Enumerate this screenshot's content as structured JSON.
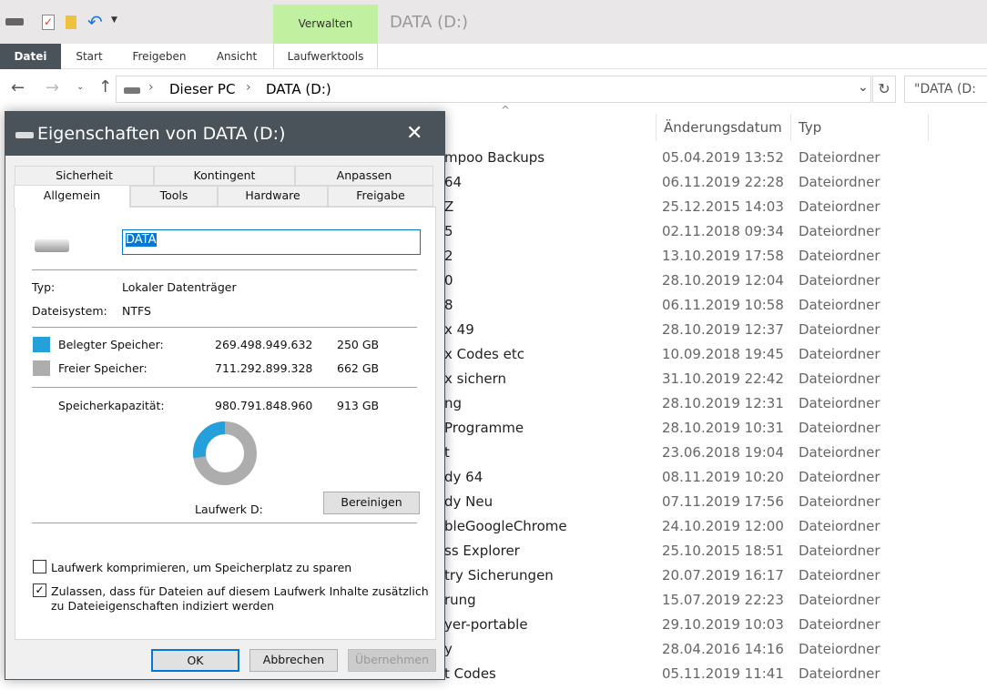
{
  "window": {
    "title": "DATA (D:)",
    "context_tab": "Verwalten",
    "accent": "#c0f0a0"
  },
  "ribbon": {
    "tabs": [
      "Datei",
      "Start",
      "Freigeben",
      "Ansicht",
      "Laufwerktools"
    ]
  },
  "address": {
    "crumbs": [
      "Dieser PC",
      "DATA (D:)"
    ],
    "search_value": "\"DATA (D:"
  },
  "columns": {
    "date": "Änderungsdatum",
    "type": "Typ"
  },
  "files": [
    {
      "name": "mpoo Backups",
      "date": "05.04.2019 13:52",
      "type": "Dateiordner"
    },
    {
      "name": "64",
      "date": "06.11.2019 22:28",
      "type": "Dateiordner"
    },
    {
      "name": "Z",
      "date": "25.12.2015 14:03",
      "type": "Dateiordner"
    },
    {
      "name": "5",
      "date": "02.11.2018 09:34",
      "type": "Dateiordner"
    },
    {
      "name": "2",
      "date": "13.10.2019 17:58",
      "type": "Dateiordner"
    },
    {
      "name": "0",
      "date": "28.10.2019 12:04",
      "type": "Dateiordner"
    },
    {
      "name": "8",
      "date": "06.11.2019 10:58",
      "type": "Dateiordner"
    },
    {
      "name": "x 49",
      "date": "28.10.2019 12:37",
      "type": "Dateiordner"
    },
    {
      "name": "x Codes etc",
      "date": "10.09.2018 19:45",
      "type": "Dateiordner"
    },
    {
      "name": "x sichern",
      "date": "31.10.2019 22:42",
      "type": "Dateiordner"
    },
    {
      "name": "ng",
      "date": "28.10.2019 12:31",
      "type": "Dateiordner"
    },
    {
      "name": "Programme",
      "date": "28.10.2019 10:31",
      "type": "Dateiordner"
    },
    {
      "name": "t",
      "date": "23.06.2018 19:04",
      "type": "Dateiordner"
    },
    {
      "name": "dy 64",
      "date": "08.11.2019 10:20",
      "type": "Dateiordner"
    },
    {
      "name": "dy Neu",
      "date": "07.11.2019 17:56",
      "type": "Dateiordner"
    },
    {
      "name": "bleGoogleChrome",
      "date": "24.10.2019 12:00",
      "type": "Dateiordner"
    },
    {
      "name": "ss Explorer",
      "date": "25.10.2015 18:51",
      "type": "Dateiordner"
    },
    {
      "name": "try Sicherungen",
      "date": "20.07.2019 16:17",
      "type": "Dateiordner"
    },
    {
      "name": "rung",
      "date": "15.07.2019 22:23",
      "type": "Dateiordner"
    },
    {
      "name": "yer-portable",
      "date": "29.10.2019 10:03",
      "type": "Dateiordner"
    },
    {
      "name": "y",
      "date": "28.04.2016 14:16",
      "type": "Dateiordner"
    },
    {
      "name": "t Codes",
      "date": "05.11.2019 11:41",
      "type": "Dateiordner"
    }
  ],
  "dialog": {
    "title": "Eigenschaften von DATA (D:)",
    "tabs_row1": [
      "Sicherheit",
      "Kontingent",
      "Anpassen"
    ],
    "tabs_row2": [
      "Allgemein",
      "Tools",
      "Hardware",
      "Freigabe"
    ],
    "name_value": "DATA",
    "type_label": "Typ:",
    "type_value": "Lokaler Datenträger",
    "fs_label": "Dateisystem:",
    "fs_value": "NTFS",
    "used": {
      "label": "Belegter Speicher:",
      "bytes": "269.498.949.632",
      "size": "250 GB",
      "color": "#26a0da"
    },
    "free": {
      "label": "Freier Speicher:",
      "bytes": "711.292.899.328",
      "size": "662 GB",
      "color": "#adadad"
    },
    "capacity": {
      "label": "Speicherkapazität:",
      "bytes": "980.791.848.960",
      "size": "913 GB"
    },
    "used_fraction": 0.274,
    "drive_label": "Laufwerk D:",
    "cleanup": "Bereinigen",
    "compress": {
      "label": "Laufwerk komprimieren, um Speicherplatz zu sparen",
      "checked": false
    },
    "index": {
      "label1": "Zulassen, dass für Dateien auf diesem Laufwerk Inhalte zusätzlich",
      "label2": "zu Dateieigenschaften indiziert werden",
      "checked": true
    },
    "ok": "OK",
    "cancel": "Abbrechen",
    "apply": "Übernehmen"
  }
}
